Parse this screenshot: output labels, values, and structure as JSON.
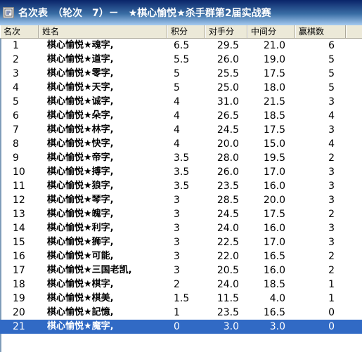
{
  "window": {
    "title": "名次表　（轮次　7）－　★棋心愉悦★杀手群第2届实战赛",
    "icon": "app-window-icon"
  },
  "columns": {
    "rank": "名次",
    "name": "姓名",
    "score": "积分",
    "opponent": "对手分",
    "middle": "中间分",
    "wins": "赢棋数"
  },
  "selection_color": "#316ac5",
  "rows": [
    {
      "rank": "1",
      "name": "棋心愉悦★魂字,",
      "score": "6.5",
      "opponent": "29.5",
      "middle": "21.0",
      "wins": "6"
    },
    {
      "rank": "2",
      "name": "棋心愉悦★道字,",
      "score": "5.5",
      "opponent": "26.0",
      "middle": "19.0",
      "wins": "5"
    },
    {
      "rank": "3",
      "name": "棋心愉悦★零字,",
      "score": "5",
      "opponent": "25.5",
      "middle": "17.5",
      "wins": "5"
    },
    {
      "rank": "4",
      "name": "棋心愉悦★天字,",
      "score": "5",
      "opponent": "25.0",
      "middle": "18.0",
      "wins": "5"
    },
    {
      "rank": "5",
      "name": "棋心愉悦★诚字,",
      "score": "4",
      "opponent": "31.0",
      "middle": "21.5",
      "wins": "3"
    },
    {
      "rank": "6",
      "name": "棋心愉悦★朵字,",
      "score": "4",
      "opponent": "26.5",
      "middle": "18.5",
      "wins": "4"
    },
    {
      "rank": "7",
      "name": "棋心愉悦★林字,",
      "score": "4",
      "opponent": "24.5",
      "middle": "17.5",
      "wins": "3"
    },
    {
      "rank": "8",
      "name": "棋心愉悦★快字,",
      "score": "4",
      "opponent": "20.0",
      "middle": "15.0",
      "wins": "4"
    },
    {
      "rank": "9",
      "name": "棋心愉悦★帝字,",
      "score": "3.5",
      "opponent": "28.0",
      "middle": "19.5",
      "wins": "2"
    },
    {
      "rank": "10",
      "name": "棋心愉悦★搏字,",
      "score": "3.5",
      "opponent": "26.0",
      "middle": "17.0",
      "wins": "3"
    },
    {
      "rank": "11",
      "name": "棋心愉悦★狼字,",
      "score": "3.5",
      "opponent": "23.5",
      "middle": "16.0",
      "wins": "3"
    },
    {
      "rank": "12",
      "name": "棋心愉悦★琴字,",
      "score": "3",
      "opponent": "28.5",
      "middle": "20.0",
      "wins": "3"
    },
    {
      "rank": "13",
      "name": "棋心愉悦★魄字,",
      "score": "3",
      "opponent": "24.5",
      "middle": "17.5",
      "wins": "2"
    },
    {
      "rank": "14",
      "name": "棋心愉悦★利字,",
      "score": "3",
      "opponent": "24.0",
      "middle": "16.0",
      "wins": "3"
    },
    {
      "rank": "15",
      "name": "棋心愉悦★狮字,",
      "score": "3",
      "opponent": "22.5",
      "middle": "17.0",
      "wins": "3"
    },
    {
      "rank": "16",
      "name": "棋心愉悦★可能,",
      "score": "3",
      "opponent": "22.0",
      "middle": "16.5",
      "wins": "2"
    },
    {
      "rank": "17",
      "name": "棋心愉悦★三国老凯,",
      "score": "3",
      "opponent": "20.5",
      "middle": "16.0",
      "wins": "2"
    },
    {
      "rank": "18",
      "name": "棋心愉悦★棋字,",
      "score": "2",
      "opponent": "24.0",
      "middle": "18.5",
      "wins": "1"
    },
    {
      "rank": "19",
      "name": "棋心愉悦★棋美,",
      "score": "1.5",
      "opponent": "11.5",
      "middle": "4.0",
      "wins": "1"
    },
    {
      "rank": "20",
      "name": "棋心愉悦★記憶,",
      "score": "1",
      "opponent": "23.5",
      "middle": "16.5",
      "wins": "0"
    },
    {
      "rank": "21",
      "name": "棋心愉悦★魔字,",
      "score": "0",
      "opponent": "3.0",
      "middle": "3.0",
      "wins": "0",
      "selected": true
    }
  ]
}
